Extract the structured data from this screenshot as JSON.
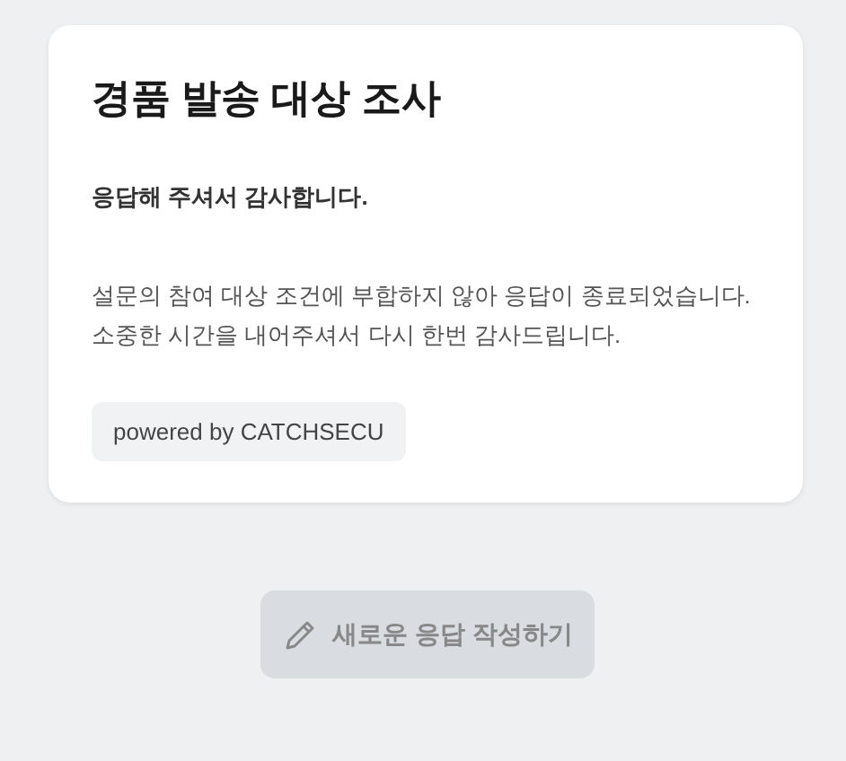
{
  "card": {
    "title": "경품 발송 대상 조사",
    "thanks": "응답해 주셔서 감사합니다.",
    "message_lines": [
      "설문의 참여 대상 조건에 부합하지 않아 응답이 종료되었습니다.",
      "소중한 시간을 내어주셔서 다시 한번 감사드립니다."
    ],
    "badge": "powered by CATCHSECU"
  },
  "new_response_button": {
    "label": "새로운 응답 작성하기",
    "disabled": true
  }
}
